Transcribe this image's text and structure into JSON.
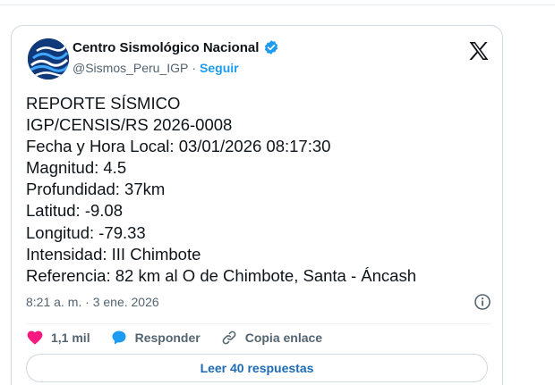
{
  "account": {
    "name": "Centro Sismológico Nacional",
    "handle": "@Sismos_Peru_IGP",
    "separator": "·",
    "follow_label": "Seguir"
  },
  "icons": {
    "verified": "verified-badge-icon",
    "platform": "x-logo-icon",
    "info": "info-icon",
    "like": "heart-icon",
    "reply": "reply-bubble-icon",
    "copy_link": "link-icon"
  },
  "post": {
    "lines": [
      "REPORTE SÍSMICO",
      "IGP/CENSIS/RS 2026-0008",
      "Fecha y Hora Local: 03/01/2026 08:17:30",
      "Magnitud: 4.5",
      "Profundidad: 37km",
      "Latitud: -9.08",
      "Longitud: -79.33",
      "Intensidad: III Chimbote",
      "Referencia: 82 km al O de Chimbote, Santa - Áncash"
    ],
    "timestamp": "8:21 a. m. · 3 ene. 2026"
  },
  "actions": {
    "likes": "1,1 mil",
    "reply_label": "Responder",
    "copy_label": "Copia enlace"
  },
  "read_replies_label": "Leer 40 respuestas",
  "colors": {
    "accent": "#1d9bf0",
    "like": "#f91880",
    "reply": "#1d9bf0",
    "avatar_bg": "#10397a"
  }
}
